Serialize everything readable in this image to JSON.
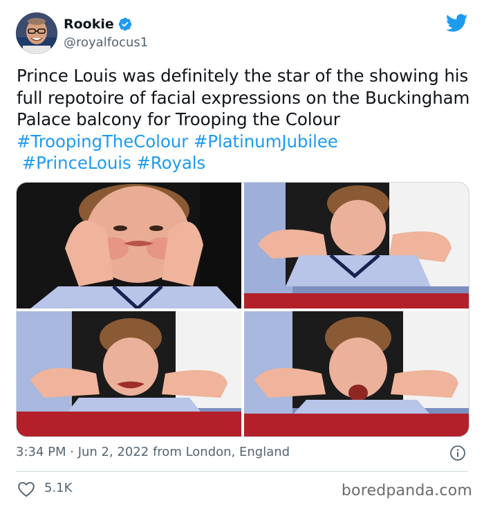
{
  "tweet": {
    "display_name": "Rookie",
    "handle": "@royalfocus1",
    "verified_icon": "verified-badge-icon",
    "platform_icon": "twitter-bird-icon",
    "text_plain": "Prince Louis was definitely the star of the showing his full repotoire of facial expressions on the Buckingham Palace balcony for Trooping the Colour ",
    "hashtags": [
      "#TroopingTheColour",
      "#PlatinumJubilee",
      "#PrinceLouis",
      "#Royals"
    ],
    "timestamp": "3:34 PM · Jun 2, 2022 from London, England",
    "likes": "5.1K"
  },
  "colors": {
    "accent": "#1d9bf0",
    "text": "#0f1419",
    "muted": "#536471",
    "border": "#cfd9de"
  },
  "media": {
    "count": 4,
    "photos": [
      "photo-1",
      "photo-2",
      "photo-3",
      "photo-4"
    ]
  },
  "watermark": "boredpanda.com"
}
